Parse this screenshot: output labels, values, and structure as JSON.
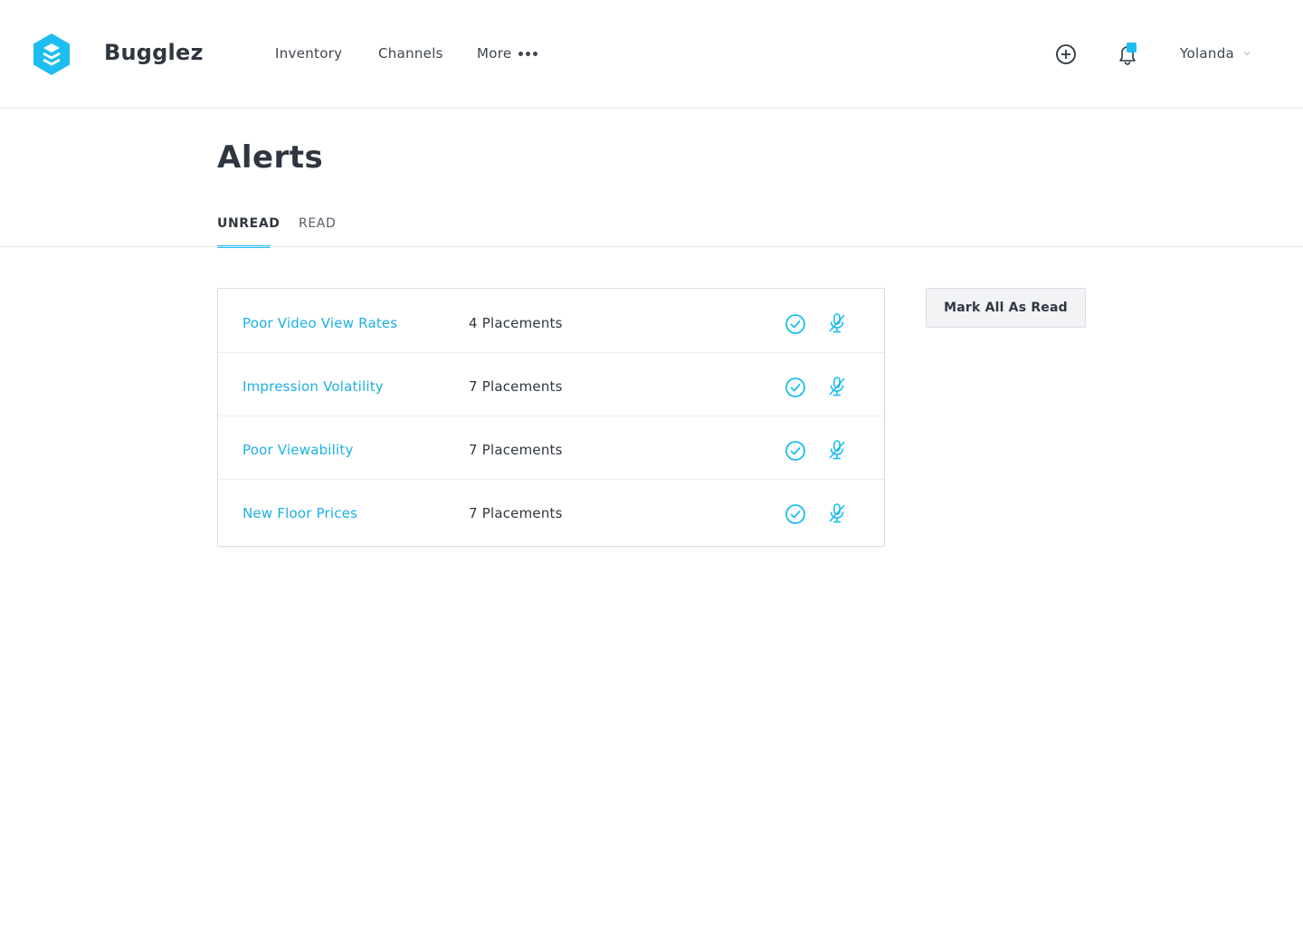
{
  "header": {
    "brand": "Bugglez",
    "nav": {
      "inventory": "Inventory",
      "channels": "Channels",
      "more": "More"
    },
    "user": "Yolanda"
  },
  "colors": {
    "accent": "#1cbdf0",
    "link": "#1cb0e3",
    "text": "#2f3640"
  },
  "page": {
    "title": "Alerts",
    "tabs": [
      {
        "label": "UNREAD",
        "active": true
      },
      {
        "label": "READ",
        "active": false
      }
    ],
    "mark_all_label": "Mark All As Read"
  },
  "alerts": [
    {
      "name": "Poor Video View Rates",
      "count": "4 Placements"
    },
    {
      "name": "Impression Volatility",
      "count": "7 Placements"
    },
    {
      "name": "Poor Viewability",
      "count": "7 Placements"
    },
    {
      "name": "New Floor Prices",
      "count": "7 Placements"
    }
  ],
  "icons": {
    "logo": "bugglez-logo-icon",
    "add": "plus-circle-icon",
    "notifications": "bell-icon",
    "user_caret": "chevron-down-icon",
    "mark_read": "check-circle-icon",
    "mute": "microphone-off-icon"
  }
}
